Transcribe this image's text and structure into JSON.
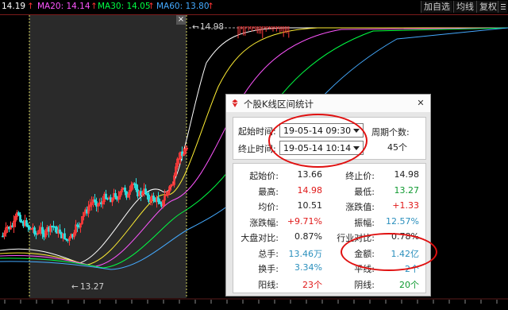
{
  "ma": {
    "price": "14.19",
    "ma20": "MA20: 14.14",
    "ma30": "MA30: 14.05",
    "ma60": "MA60: 13.80",
    "up_arrow": "↑",
    "colors": {
      "price": "#ffffff",
      "ma20": "#ff55ff",
      "ma30": "#00ff44",
      "ma60": "#44aaff",
      "arrow": "#ff3333"
    }
  },
  "toolbar": {
    "add": "加自选",
    "avg": "均线",
    "fq": "复权",
    "menu_icon": "menu-icon"
  },
  "chart": {
    "high_label": "14.98",
    "low_label": "13.27",
    "arrow_left": "←",
    "close_x": "×"
  },
  "dialog": {
    "title": "个股K线区间统计",
    "close": "✕",
    "start_label": "起始时间:",
    "start_value": "19-05-14 09:30",
    "end_label": "终止时间:",
    "end_value": "19-05-14 10:14",
    "period_label": "周期个数:",
    "period_value": "45个",
    "stats_left": [
      {
        "label": "起始价:",
        "value": "13.66",
        "color": "#222222"
      },
      {
        "label": "最高:",
        "value": "14.98",
        "color": "#e01818"
      },
      {
        "label": "均价:",
        "value": "10.51",
        "color": "#222222"
      },
      {
        "label": "涨跌幅:",
        "value": "+9.71%",
        "color": "#e01818"
      },
      {
        "label": "大盘对比:",
        "value": "0.87%",
        "color": "#222222"
      },
      {
        "label": "总手:",
        "value": "13.46万",
        "color": "#2a8fbd"
      },
      {
        "label": "换手:",
        "value": "3.34%",
        "color": "#2a8fbd"
      },
      {
        "label": "阳线:",
        "value": "23个",
        "color": "#e01818"
      }
    ],
    "stats_right": [
      {
        "label": "终止价:",
        "value": "14.98",
        "color": "#222222"
      },
      {
        "label": "最低:",
        "value": "13.27",
        "color": "#0f9a30"
      },
      {
        "label": "涨跌值:",
        "value": "+1.33",
        "color": "#e01818"
      },
      {
        "label": "振幅:",
        "value": "12.57%",
        "color": "#2a8fbd"
      },
      {
        "label": "行业对比:",
        "value": "0.78%",
        "color": "#222222"
      },
      {
        "label": "金额:",
        "value": "1.42亿",
        "color": "#2a8fbd"
      },
      {
        "label": "平线:",
        "value": "2个",
        "color": "#2a8fbd"
      },
      {
        "label": "阴线:",
        "value": "20个",
        "color": "#0f9a30"
      }
    ]
  }
}
